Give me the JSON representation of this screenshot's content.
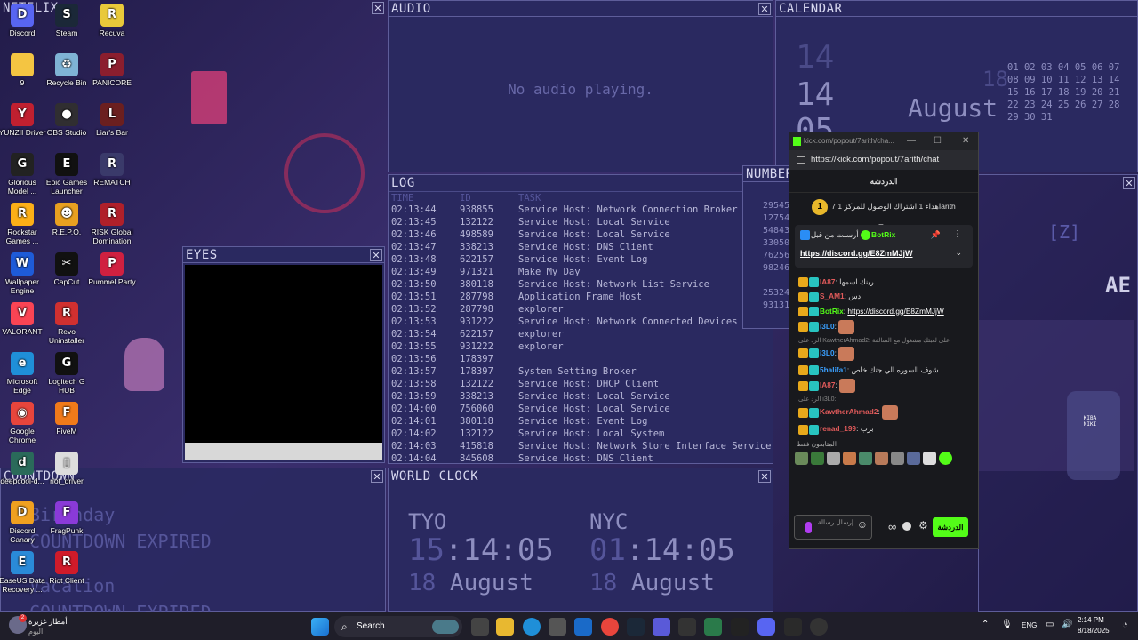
{
  "desktop": {
    "icons": [
      {
        "label": "Discord",
        "color": "#5865f2",
        "glyph": "D"
      },
      {
        "label": "Steam",
        "color": "#1b2838",
        "glyph": "S"
      },
      {
        "label": "Recuva",
        "color": "#e9c93a",
        "glyph": "R"
      },
      {
        "label": "9",
        "color": "#f4c542",
        "glyph": ""
      },
      {
        "label": "Recycle Bin",
        "color": "#7fb3d5",
        "glyph": "♻"
      },
      {
        "label": "PANICORE",
        "color": "#8b1e2e",
        "glyph": "P"
      },
      {
        "label": "YUNZII Driver",
        "color": "#c02030",
        "glyph": "Y"
      },
      {
        "label": "OBS Studio",
        "color": "#302e31",
        "glyph": "●"
      },
      {
        "label": "Liar's Bar",
        "color": "#6b1f1f",
        "glyph": "L"
      },
      {
        "label": "Glorious Model ...",
        "color": "#222222",
        "glyph": "G"
      },
      {
        "label": "Epic Games Launcher",
        "color": "#111111",
        "glyph": "E"
      },
      {
        "label": "REMATCH",
        "color": "#3a3a6a",
        "glyph": "R"
      },
      {
        "label": "Rockstar Games ...",
        "color": "#fcaf17",
        "glyph": "R"
      },
      {
        "label": "R.E.P.O.",
        "color": "#e8a020",
        "glyph": "☻"
      },
      {
        "label": "RISK Global Domination",
        "color": "#b0202a",
        "glyph": "R"
      },
      {
        "label": "Wallpaper Engine",
        "color": "#1e5bd8",
        "glyph": "W"
      },
      {
        "label": "CapCut",
        "color": "#111111",
        "glyph": "✂"
      },
      {
        "label": "Pummel Party",
        "color": "#d02040",
        "glyph": "P"
      },
      {
        "label": "VALORANT",
        "color": "#fa4454",
        "glyph": "V"
      },
      {
        "label": "Revo Uninstaller",
        "color": "#d03030",
        "glyph": "R"
      },
      {
        "label": "",
        "color": "transparent",
        "glyph": ""
      },
      {
        "label": "Microsoft Edge",
        "color": "#1f8fd8",
        "glyph": "e"
      },
      {
        "label": "Logitech G HUB",
        "color": "#111111",
        "glyph": "G"
      },
      {
        "label": "",
        "color": "transparent",
        "glyph": ""
      },
      {
        "label": "Google Chrome",
        "color": "#e8453c",
        "glyph": "◉"
      },
      {
        "label": "FiveM",
        "color": "#f07a1a",
        "glyph": "F"
      },
      {
        "label": "",
        "color": "transparent",
        "glyph": ""
      },
      {
        "label": "deepcool-d...",
        "color": "#2a6a5a",
        "glyph": "d"
      },
      {
        "label": "riot_driver",
        "color": "#dddddd",
        "glyph": "▯"
      },
      {
        "label": "",
        "color": "transparent",
        "glyph": ""
      },
      {
        "label": "Discord Canary",
        "color": "#f0a020",
        "glyph": "D"
      },
      {
        "label": "FragPunk",
        "color": "#8a3ad8",
        "glyph": "F"
      },
      {
        "label": "",
        "color": "transparent",
        "glyph": ""
      },
      {
        "label": "EaseUS Data Recovery ...",
        "color": "#2a8ad8",
        "glyph": "E"
      },
      {
        "label": "Riot Client",
        "color": "#d01b2a",
        "glyph": "R"
      },
      {
        "label": "",
        "color": "transparent",
        "glyph": ""
      }
    ]
  },
  "panels": {
    "netflix_title": "NETFLIX",
    "audio_title": "AUDIO",
    "audio_status": "No audio playing.",
    "calendar_title": "CALENDAR",
    "calendar": {
      "prev_day": "14",
      "day_big": "14",
      "partial": "05",
      "side_day": "18",
      "month": "August",
      "rows": [
        "01 02 03 04 05 06 07",
        "08 09 10 11 12 13 14",
        "15 16 17 18 19 20 21",
        "22 23 24 25 26 27 28",
        "29 30 31"
      ]
    },
    "eyes_title": "EYES",
    "log_title": "LOG",
    "log_headers": [
      "TIME",
      "ID",
      "TASK"
    ],
    "log_rows": [
      [
        "02:13:44",
        "938855",
        "Service Host: Network Connection Broker"
      ],
      [
        "02:13:45",
        "132122",
        "Service Host: Local Service"
      ],
      [
        "02:13:46",
        "498589",
        "Service Host: Local Service"
      ],
      [
        "02:13:47",
        "338213",
        "Service Host: DNS Client"
      ],
      [
        "02:13:48",
        "622157",
        "Service Host: Event Log"
      ],
      [
        "02:13:49",
        "971321",
        "Make My Day"
      ],
      [
        "02:13:50",
        "380118",
        "Service Host: Network List Service"
      ],
      [
        "02:13:51",
        "287798",
        "Application Frame Host"
      ],
      [
        "02:13:52",
        "287798",
        "explorer"
      ],
      [
        "02:13:53",
        "931222",
        "Service Host: Network Connected Devices"
      ],
      [
        "02:13:54",
        "622157",
        "explorer"
      ],
      [
        "02:13:55",
        "931222",
        "explorer"
      ],
      [
        "02:13:56",
        "178397",
        ""
      ],
      [
        "02:13:57",
        "178397",
        "System Setting Broker"
      ],
      [
        "02:13:58",
        "132122",
        "Service Host: DHCP Client"
      ],
      [
        "02:13:59",
        "338213",
        "Service Host: Local Service"
      ],
      [
        "02:14:00",
        "756060",
        "Service Host: Local Service"
      ],
      [
        "02:14:01",
        "380118",
        "Service Host: Event Log"
      ],
      [
        "02:14:02",
        "132122",
        "Service Host: Local System"
      ],
      [
        "02:14:03",
        "415818",
        "Service Host: Network Store Interface Service"
      ],
      [
        "02:14:04",
        "845608",
        "Service Host: DNS Client"
      ]
    ],
    "numbers_title": "NUMBER",
    "numbers": [
      "29545",
      "12754",
      "54843",
      "33050",
      "76256",
      "98246",
      "",
      "25324",
      "93131"
    ],
    "countdown_title": "COUNTDOWN",
    "countdown_lines": [
      "Birthday",
      "COUNTDOWN EXPIRED",
      "Vacation",
      "COUNTDOWN EXPIRED"
    ],
    "worldclock_title": "WORLD CLOCK",
    "clocks": [
      {
        "city": "TYO",
        "hour": "15",
        "rest": ":14:05",
        "day": "18",
        "month": "August"
      },
      {
        "city": "NYC",
        "hour": "01",
        "rest": ":14:05",
        "day": "18",
        "month": "August"
      }
    ],
    "right_panel": {
      "z_label": "[Z]",
      "ae_label": "AE",
      "sign": "KIBA NIKI"
    }
  },
  "kick": {
    "window_title": "kick.com/popout/7arith/cha...",
    "url": "https://kick.com/popout/7arith/chat",
    "chat_header": "الدردشة",
    "goal_coin": "1",
    "goal_text": "اهداء 1 اشتراك الوصول للمركز 1 7arith",
    "pinned_prefix": "أرسلت من قبل",
    "pinned_user": "BotRix",
    "pinned_link": "https://discord.gg/E8ZmMJjW",
    "messages": [
      {
        "user": "IA87",
        "color": "#e05a5a",
        "text": "رينك اسمها"
      },
      {
        "user": "S_AM1",
        "color": "#e05a5a",
        "text": "دس"
      },
      {
        "user": "BotRix",
        "color": "#53fc18",
        "text": "https://discord.gg/E8ZmMJjW"
      },
      {
        "user": "i3L0",
        "color": "#3aa0ff",
        "text": ""
      },
      {
        "reply": "الرد على KawtherAhmad2: على لعبتك مشغول مع السالفة"
      },
      {
        "user": "i3L0",
        "color": "#3aa0ff",
        "text": ""
      },
      {
        "user": "5halifa1",
        "color": "#3aa0ff",
        "text": "شوف السوره الي جتك خاص"
      },
      {
        "user": "IA87",
        "color": "#e05a5a",
        "text": ""
      },
      {
        "reply": "الرد على i3L0:"
      },
      {
        "user": "KawtherAhmad2",
        "color": "#e05a5a",
        "text": ""
      },
      {
        "user": "renad_199",
        "color": "#e05a5a",
        "text": "برب"
      }
    ],
    "viewers_label": "المتابعون فقط",
    "input_placeholder": "إرسال رسالة",
    "send_label": "الدردشة"
  },
  "taskbar": {
    "weather_temp": "أمطار غزيرة",
    "weather_sub": "اليوم",
    "search_label": "Search",
    "language": "ENG",
    "time": "2:14 PM",
    "date": "8/18/2025",
    "notification_count": "2"
  }
}
